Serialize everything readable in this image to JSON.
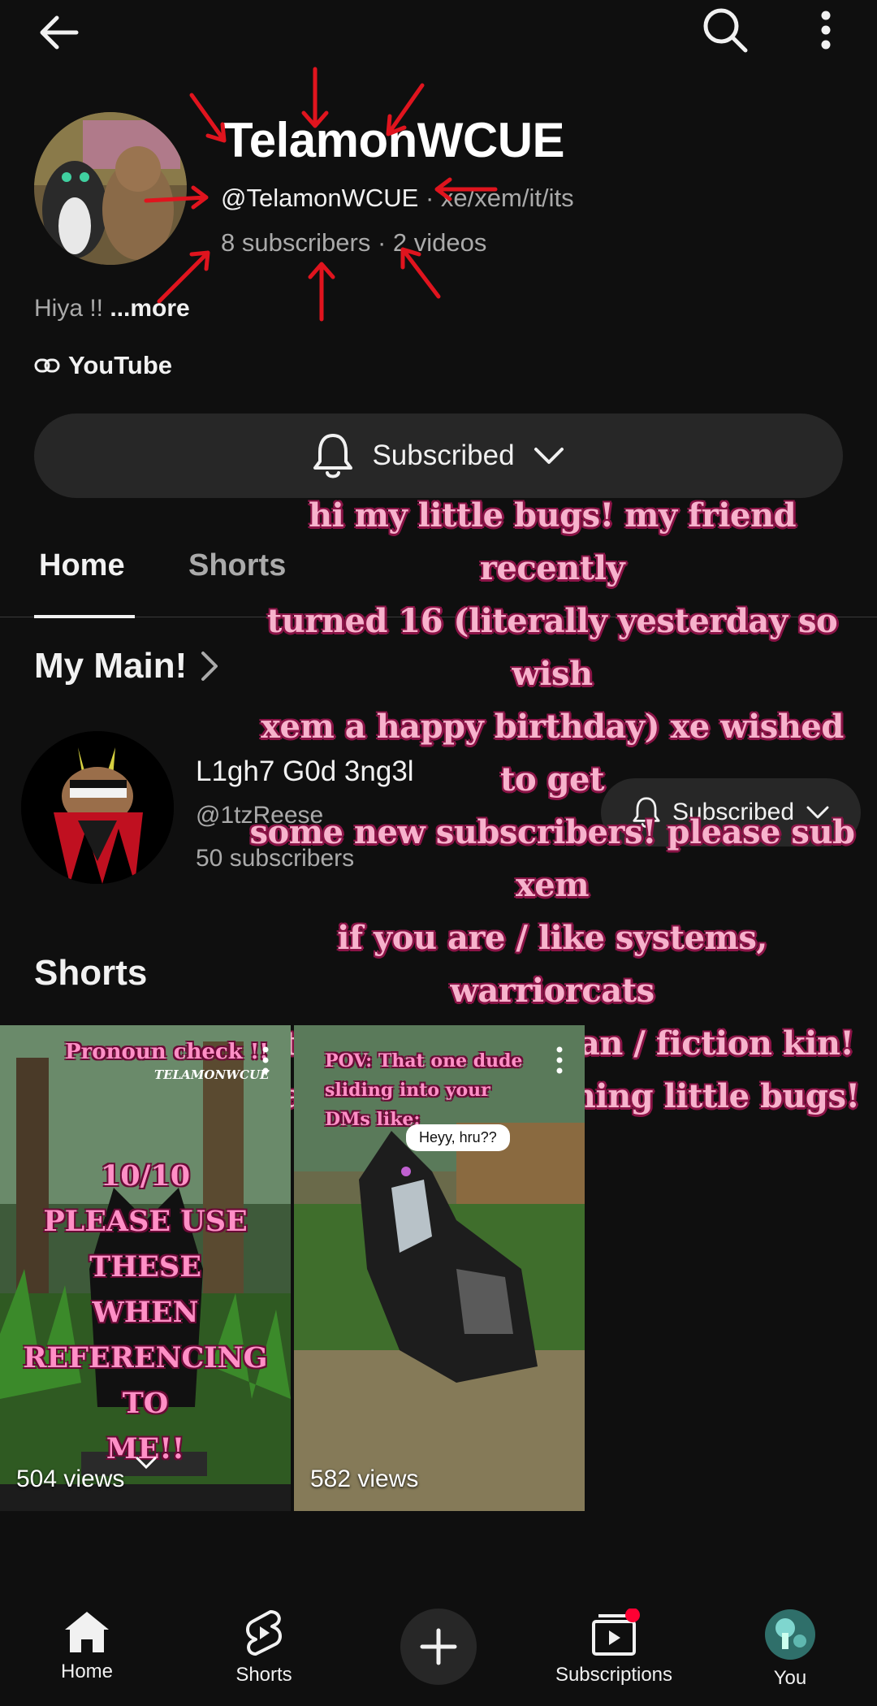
{
  "channel": {
    "title": "TelamonWCUE",
    "handle": "@TelamonWCUE",
    "pronouns": "xe/xem/it/its",
    "subscribers": "8 subscribers",
    "videos": "2 videos",
    "description": "Hiya !! ",
    "more_label": "...more",
    "link_label": "YouTube",
    "subscribe_label": "Subscribed"
  },
  "tabs": [
    {
      "label": "Home"
    },
    {
      "label": "Shorts"
    }
  ],
  "featured": {
    "section_title": "My Main!",
    "channel_name": "L1gh7 G0d 3ng3l",
    "handle": "@1tzReese",
    "subscribers": "50 subscribers",
    "subscribe_label": "Subscribed"
  },
  "overlay_text": [
    "hi my little bugs! my friend recently",
    "turned 16 (literally yesterday so wish",
    "xem a happy birthday) xe wished to get",
    "some new subscribers! please sub xem",
    "if you are / like systems, warriorcats",
    "alterhuman / therian / fiction kin!",
    "thank you for listening little bugs!"
  ],
  "shorts_section": {
    "title": "Shorts",
    "items": [
      {
        "title_overlay": "Pronoun check !!",
        "watermark": "TELAMONWCUE",
        "caption_lines": [
          "10/10",
          "PLEASE USE THESE",
          "WHEN",
          "REFERENCING TO",
          "ME!!"
        ],
        "views": "504 views"
      },
      {
        "caption_lines": [
          "POV: That one dude",
          "sliding into your",
          "DMs like:"
        ],
        "speech": "Heyy, hru??",
        "views": "582 views"
      }
    ]
  },
  "bottom_nav": [
    {
      "label": "Home",
      "icon": "home-icon"
    },
    {
      "label": "Shorts",
      "icon": "shorts-icon"
    },
    {
      "label": "",
      "icon": "create-icon"
    },
    {
      "label": "Subscriptions",
      "icon": "subscriptions-icon"
    },
    {
      "label": "You",
      "icon": "profile-avatar"
    }
  ],
  "colors": {
    "background": "#0f0f0f",
    "chip": "#272727",
    "overlay_text": "#f7b2cc",
    "annotation_arrows": "#e0141e",
    "notification_dot": "#ff0033"
  }
}
